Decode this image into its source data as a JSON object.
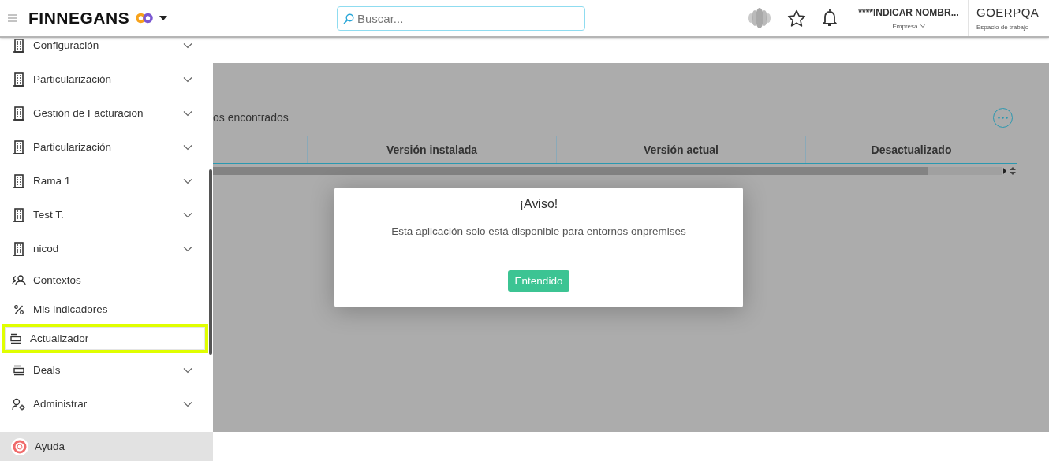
{
  "header": {
    "brand": "FINNEGANS",
    "search": {
      "placeholder": "Buscar..."
    },
    "company": {
      "name": "****INDICAR NOMBR...",
      "label": "Empresa"
    },
    "workspace": {
      "name": "GOERPQA",
      "label": "Espacio de trabajo"
    }
  },
  "sidebar": {
    "items": [
      {
        "label": "Configuración",
        "kind": "building",
        "expandable": true,
        "selected": false
      },
      {
        "label": "Particularización",
        "kind": "building",
        "expandable": true,
        "selected": false
      },
      {
        "label": "Gestión de Facturacion",
        "kind": "building",
        "expandable": true,
        "selected": false
      },
      {
        "label": "Particularización",
        "kind": "building",
        "expandable": true,
        "selected": false
      },
      {
        "label": "Rama 1",
        "kind": "building",
        "expandable": true,
        "selected": false
      },
      {
        "label": "Test T.",
        "kind": "building",
        "expandable": true,
        "selected": false
      },
      {
        "label": "nicod",
        "kind": "building",
        "expandable": true,
        "selected": false
      },
      {
        "label": "Contextos",
        "kind": "people",
        "expandable": false,
        "selected": false
      },
      {
        "label": "Mis Indicadores",
        "kind": "percent",
        "expandable": false,
        "selected": false
      },
      {
        "label": "Actualizador",
        "kind": "list",
        "expandable": false,
        "selected": true
      },
      {
        "label": "Deals",
        "kind": "list",
        "expandable": true,
        "selected": false
      },
      {
        "label": "Administrar",
        "kind": "user-gear",
        "expandable": true,
        "selected": false
      }
    ],
    "footer": {
      "label": "Ayuda"
    }
  },
  "main": {
    "result_text": "os encontrados",
    "table": {
      "columns": [
        "Versión instalada",
        "Versión actual",
        "Desactualizado"
      ]
    }
  },
  "dialog": {
    "title": "¡Aviso!",
    "message": "Esta aplicación solo está disponible para entornos onpremises",
    "button": "Entendido"
  }
}
